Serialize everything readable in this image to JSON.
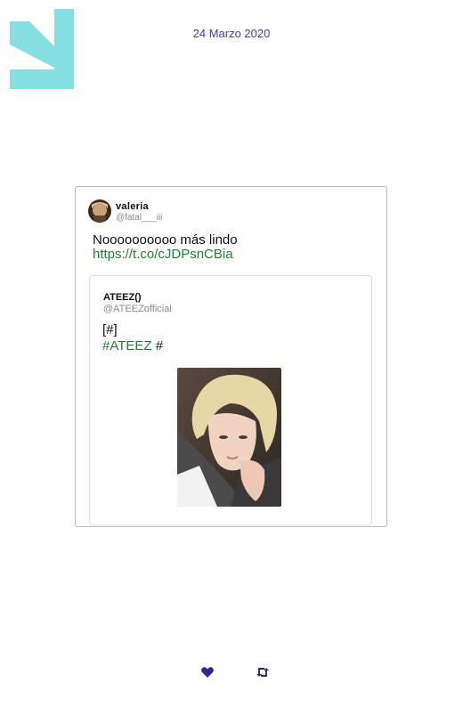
{
  "header": {
    "date": "24 Marzo 2020"
  },
  "tweet": {
    "user_name": "valeria",
    "user_handle": "@fatal___iii",
    "text": "Noooooooooo más lindo",
    "link": "https://t.co/cJDPsnCBia",
    "quoted": {
      "user_name": "ATEEZ()",
      "user_handle": "@ATEEZofficial",
      "line1": "[#]",
      "hashtag": "#ATEEZ",
      "line2_suffix": " #"
    }
  },
  "footer": {
    "icons": [
      "heart-icon",
      "retweet-icon"
    ]
  },
  "colors": {
    "logo": "#86dfe0",
    "date": "#4a3c9a",
    "link": "#2a7a3a",
    "icons": "#2a2a8a"
  }
}
